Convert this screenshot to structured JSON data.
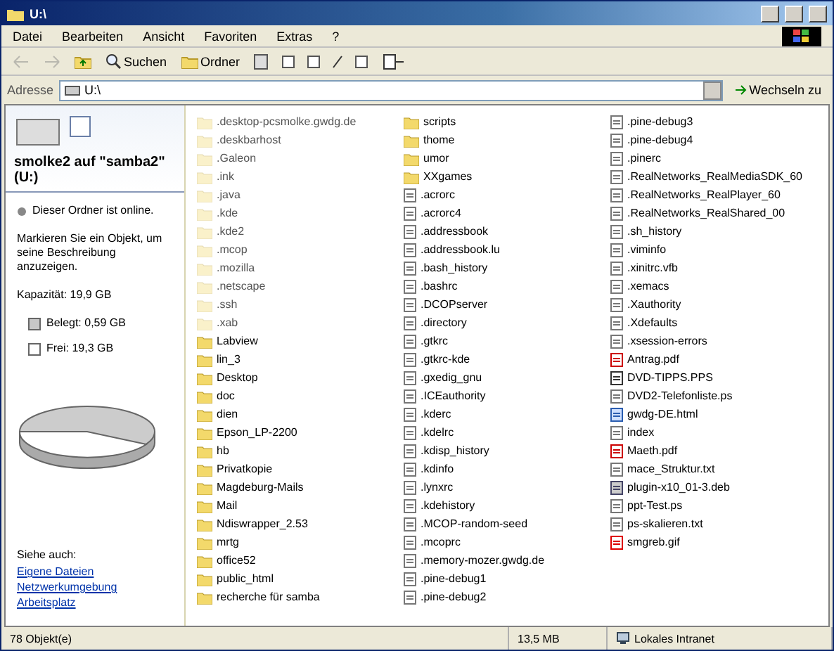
{
  "window": {
    "title": "U:\\"
  },
  "menu": [
    "Datei",
    "Bearbeiten",
    "Ansicht",
    "Favoriten",
    "Extras",
    "?"
  ],
  "toolbar": {
    "buttons": [
      {
        "kind": "back",
        "disabled": true
      },
      {
        "kind": "forward",
        "disabled": true
      },
      {
        "kind": "up",
        "disabled": false
      },
      {
        "kind": "search",
        "label": "Suchen",
        "disabled": false
      },
      {
        "kind": "folders",
        "label": "Ordner",
        "disabled": false
      }
    ]
  },
  "address": {
    "label": "Adresse",
    "value": "U:\\",
    "go": "Wechseln zu"
  },
  "info_panel": {
    "title": "smolke2 auf \"samba2\" (U:)",
    "online": "Dieser Ordner ist online.",
    "hint": "Markieren Sie ein Objekt, um seine Beschreibung anzuzeigen.",
    "capacity": "Kapazität: 19,9 GB",
    "used": "Belegt: 0,59 GB",
    "free": "Frei: 19,3 GB",
    "see_also": "Siehe auch:",
    "links": [
      "Eigene Dateien",
      "Netzwerkumgebung",
      "Arbeitsplatz"
    ]
  },
  "files": [
    {
      "name": ".desktop-pcsmolke.gwdg.de",
      "kind": "hidden-folder"
    },
    {
      "name": ".deskbarhost",
      "kind": "hidden-folder"
    },
    {
      "name": ".Galeon",
      "kind": "hidden-folder"
    },
    {
      "name": ".ink",
      "kind": "hidden-folder"
    },
    {
      "name": ".java",
      "kind": "hidden-folder"
    },
    {
      "name": ".kde",
      "kind": "hidden-folder"
    },
    {
      "name": ".kde2",
      "kind": "hidden-folder"
    },
    {
      "name": ".mcop",
      "kind": "hidden-folder"
    },
    {
      "name": ".mozilla",
      "kind": "hidden-folder"
    },
    {
      "name": ".netscape",
      "kind": "hidden-folder"
    },
    {
      "name": ".ssh",
      "kind": "hidden-folder"
    },
    {
      "name": ".xab",
      "kind": "hidden-folder"
    },
    {
      "name": "Labview",
      "kind": "folder"
    },
    {
      "name": "lin_3",
      "kind": "folder"
    },
    {
      "name": "Desktop",
      "kind": "folder"
    },
    {
      "name": "doc",
      "kind": "folder"
    },
    {
      "name": "dien",
      "kind": "folder"
    },
    {
      "name": "Epson_LP-2200",
      "kind": "folder"
    },
    {
      "name": "hb",
      "kind": "folder"
    },
    {
      "name": "Privatkopie",
      "kind": "folder"
    },
    {
      "name": "Magdeburg-Mails",
      "kind": "folder"
    },
    {
      "name": "Mail",
      "kind": "folder"
    },
    {
      "name": "Ndiswrapper_2.53",
      "kind": "folder"
    },
    {
      "name": "mrtg",
      "kind": "folder"
    },
    {
      "name": "office52",
      "kind": "folder"
    },
    {
      "name": "public_html",
      "kind": "folder"
    },
    {
      "name": "recherche für samba",
      "kind": "folder"
    },
    {
      "name": "scripts",
      "kind": "folder"
    },
    {
      "name": "thome",
      "kind": "folder"
    },
    {
      "name": "umor",
      "kind": "folder"
    },
    {
      "name": "XXgames",
      "kind": "folder"
    },
    {
      "name": ".acrorc",
      "kind": "file"
    },
    {
      "name": ".acrorc4",
      "kind": "file"
    },
    {
      "name": ".addressbook",
      "kind": "file"
    },
    {
      "name": ".addressbook.lu",
      "kind": "file"
    },
    {
      "name": ".bash_history",
      "kind": "file"
    },
    {
      "name": ".bashrc",
      "kind": "file"
    },
    {
      "name": ".DCOPserver",
      "kind": "file"
    },
    {
      "name": ".directory",
      "kind": "file"
    },
    {
      "name": ".gtkrc",
      "kind": "file"
    },
    {
      "name": ".gtkrc-kde",
      "kind": "file"
    },
    {
      "name": ".gxedig_gnu",
      "kind": "file"
    },
    {
      "name": ".ICEauthority",
      "kind": "file"
    },
    {
      "name": ".kderc",
      "kind": "file"
    },
    {
      "name": ".kdelrc",
      "kind": "file"
    },
    {
      "name": ".kdisp_history",
      "kind": "file"
    },
    {
      "name": ".kdinfo",
      "kind": "file"
    },
    {
      "name": ".lynxrc",
      "kind": "file"
    },
    {
      "name": ".kdehistory",
      "kind": "file"
    },
    {
      "name": ".MCOP-random-seed",
      "kind": "file"
    },
    {
      "name": ".mcoprc",
      "kind": "file"
    },
    {
      "name": ".memory-mozer.gwdg.de",
      "kind": "file"
    },
    {
      "name": ".pine-debug1",
      "kind": "file"
    },
    {
      "name": ".pine-debug2",
      "kind": "file"
    },
    {
      "name": ".pine-debug3",
      "kind": "file"
    },
    {
      "name": ".pine-debug4",
      "kind": "file"
    },
    {
      "name": ".pinerc",
      "kind": "file"
    },
    {
      "name": ".RealNetworks_RealMediaSDK_60",
      "kind": "file"
    },
    {
      "name": ".RealNetworks_RealPlayer_60",
      "kind": "file"
    },
    {
      "name": ".RealNetworks_RealShared_00",
      "kind": "file"
    },
    {
      "name": ".sh_history",
      "kind": "file"
    },
    {
      "name": ".viminfo",
      "kind": "file"
    },
    {
      "name": ".xinitrc.vfb",
      "kind": "file"
    },
    {
      "name": ".xemacs",
      "kind": "file"
    },
    {
      "name": ".Xauthority",
      "kind": "file"
    },
    {
      "name": ".Xdefaults",
      "kind": "file"
    },
    {
      "name": ".xsession-errors",
      "kind": "file"
    },
    {
      "name": "Antrag.pdf",
      "kind": "pdf"
    },
    {
      "name": "DVD-TIPPS.PPS",
      "kind": "slides"
    },
    {
      "name": "DVD2-Telefonliste.ps",
      "kind": "file"
    },
    {
      "name": "gwdg-DE.html",
      "kind": "html"
    },
    {
      "name": "index",
      "kind": "file"
    },
    {
      "name": "Maeth.pdf",
      "kind": "pdf"
    },
    {
      "name": "mace_Struktur.txt",
      "kind": "file"
    },
    {
      "name": "plugin-x10_01-3.deb",
      "kind": "package"
    },
    {
      "name": "ppt-Test.ps",
      "kind": "file"
    },
    {
      "name": "ps-skalieren.txt",
      "kind": "file"
    },
    {
      "name": "smgreb.gif",
      "kind": "image"
    }
  ],
  "status_bar": {
    "objects": "78 Objekt(e)",
    "size": "13,5 MB",
    "zone": "Lokales Intranet"
  }
}
